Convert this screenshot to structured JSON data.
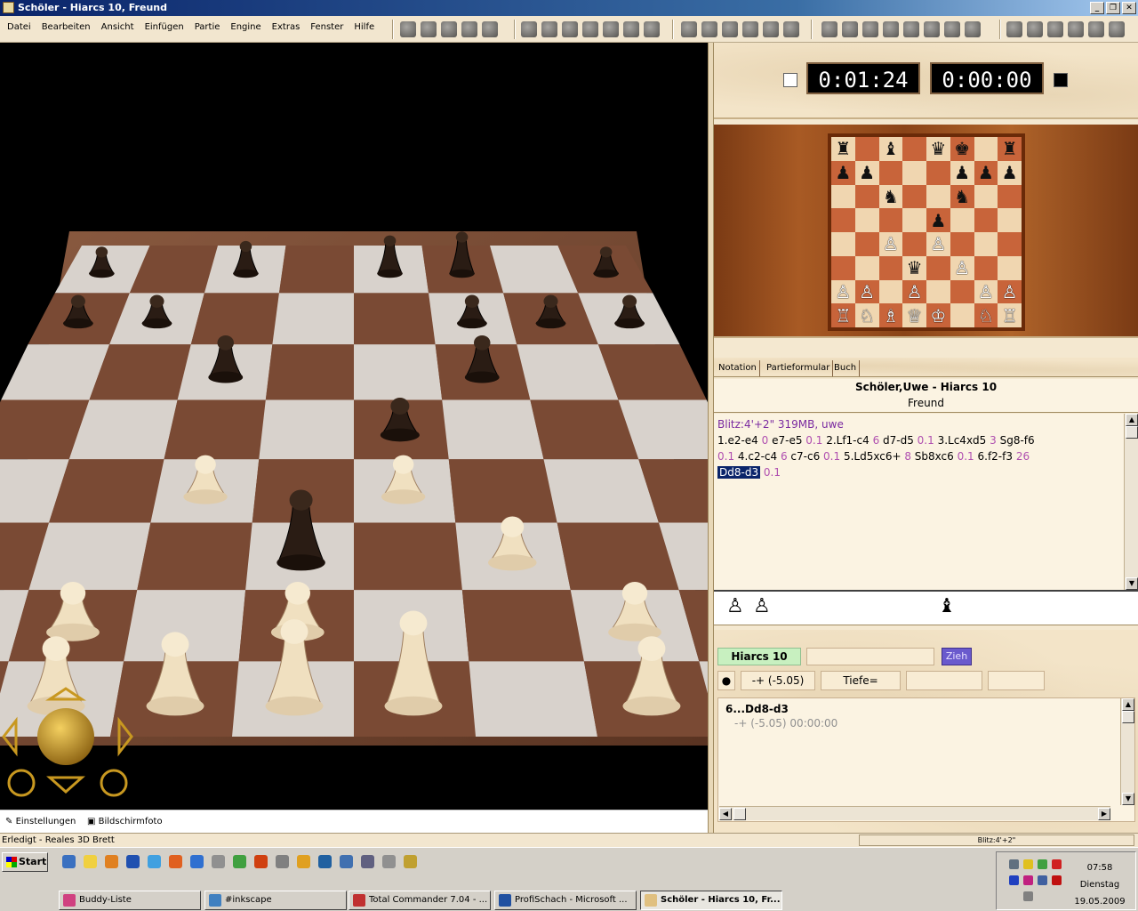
{
  "window": {
    "title": "Schöler - Hiarcs 10, Freund"
  },
  "menu": [
    "Datei",
    "Bearbeiten",
    "Ansicht",
    "Einfügen",
    "Partie",
    "Engine",
    "Extras",
    "Fenster",
    "Hilfe"
  ],
  "clocks": {
    "white": "0:01:24",
    "black": "0:00:00"
  },
  "tabs": [
    "Notation",
    "Partieformular",
    "Buch"
  ],
  "game": {
    "players": "Schöler,Uwe - Hiarcs 10",
    "event": "Freund"
  },
  "notation": {
    "header": "Blitz:4'+2\"  319MB, uwe",
    "line1": [
      {
        "m": "1.e2-e4",
        "s": "0"
      },
      {
        "m": "e7-e5",
        "s": "0.1"
      },
      {
        "m": "2.Lf1-c4",
        "s": "6"
      },
      {
        "m": "d7-d5",
        "s": "0.1"
      },
      {
        "m": "3.Lc4xd5",
        "s": "3"
      },
      {
        "m": "Sg8-f6",
        "s": ""
      }
    ],
    "line2_lead": "0.1",
    "line2": [
      {
        "m": "4.c2-c4",
        "s": "6"
      },
      {
        "m": "c7-c6",
        "s": "0.1"
      },
      {
        "m": "5.Ld5xc6+",
        "s": "8"
      },
      {
        "m": "Sb8xc6",
        "s": "0.1"
      },
      {
        "m": "6.f2-f3",
        "s": "26"
      }
    ],
    "current": "Dd8-d3",
    "current_score": "0.1"
  },
  "engine": {
    "name": "Hiarcs 10",
    "move_button": "Zieh",
    "eval": "-+  (-5.05)",
    "depth": "Tiefe=",
    "line": "6...Dd8-d3",
    "line_detail": "-+  (-5.05)    00:00:00"
  },
  "bottom": {
    "settings": "Einstellungen",
    "screenshot": "Bildschirmfoto"
  },
  "status": {
    "left": "Erledigt - Reales 3D Brett",
    "right": "Blitz:4'+2\""
  },
  "taskbar": {
    "start": "Start",
    "tasks": [
      "Buddy-Liste",
      "#inkscape",
      "Total Commander 7.04 - ...",
      "ProfiSchach - Microsoft ...",
      "Schöler - Hiarcs 10, Fr..."
    ],
    "time": "07:58",
    "day": "Dienstag",
    "date": "19.05.2009"
  },
  "miniboard": [
    "r.b.qk.r",
    "pp...ppp",
    "..n..n..",
    "....p...",
    "..P.P...",
    "...q.P..",
    "PP.P..PP",
    "RNBQK.NR"
  ]
}
